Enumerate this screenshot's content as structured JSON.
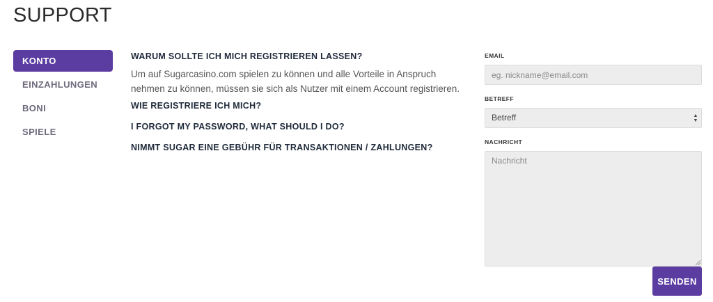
{
  "page": {
    "title": "SUPPORT"
  },
  "sidebar": {
    "items": [
      {
        "label": "KONTO",
        "active": true
      },
      {
        "label": "EINZAHLUNGEN",
        "active": false
      },
      {
        "label": "BONI",
        "active": false
      },
      {
        "label": "SPIELE",
        "active": false
      }
    ]
  },
  "faq": {
    "items": [
      {
        "question": "WARUM SOLLTE ICH MICH REGISTRIEREN LASSEN?",
        "answer": "Um auf Sugarcasino.com spielen zu können und alle Vorteile in Anspruch nehmen zu können, müssen sie sich als Nutzer mit einem Account registrieren."
      },
      {
        "question": "WIE REGISTRIERE ICH MICH?"
      },
      {
        "question": "I FORGOT MY PASSWORD, WHAT SHOULD I DO?"
      },
      {
        "question": "NIMMT SUGAR EINE GEBÜHR FÜR TRANSAKTIONEN / ZAHLUNGEN?"
      }
    ]
  },
  "form": {
    "email": {
      "label": "EMAIL",
      "placeholder": "eg. nickname@email.com",
      "value": ""
    },
    "subject": {
      "label": "BETREFF",
      "selected": "Betreff"
    },
    "message": {
      "label": "NACHRICHT",
      "placeholder": "Nachricht",
      "value": ""
    },
    "submit_label": "SENDEN"
  },
  "colors": {
    "accent": "#5b3da2",
    "input_bg": "#ededed",
    "title_text": "#2b2b2b"
  },
  "icons": {
    "select_arrows": "chevron-up-down-icon",
    "resize_grip": "resize-grip-icon"
  }
}
